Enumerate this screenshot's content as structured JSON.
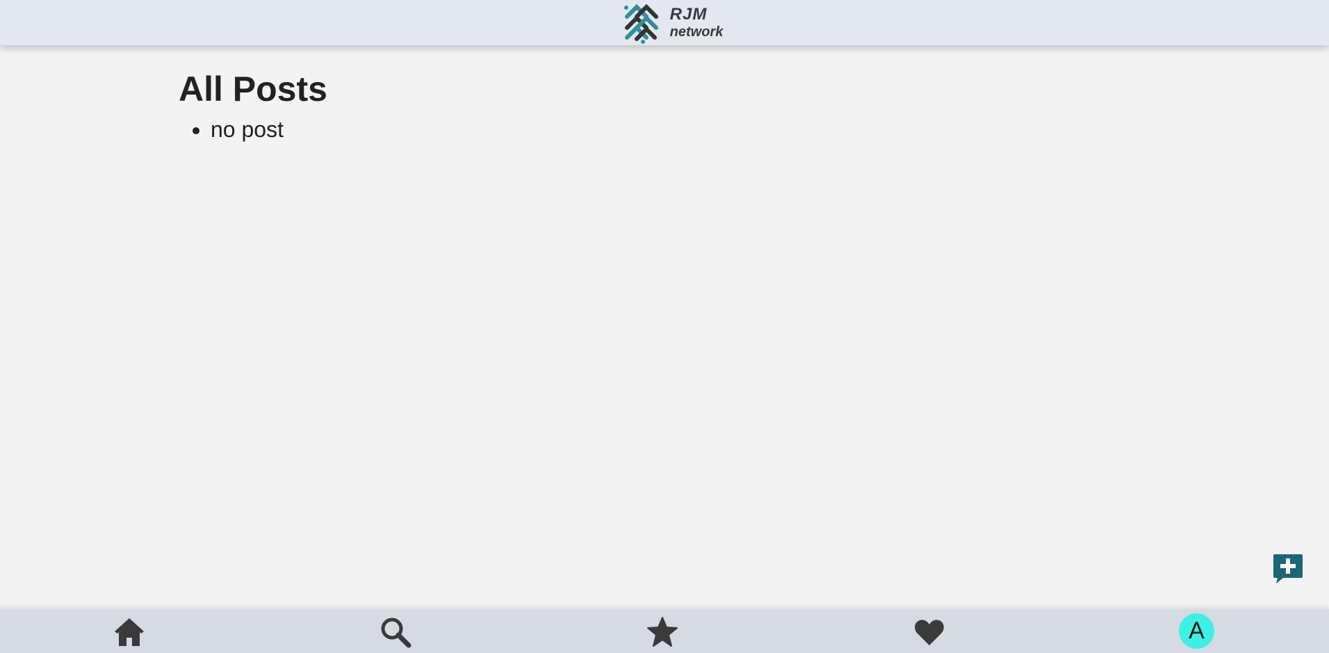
{
  "header": {
    "logo_line1": "RJM",
    "logo_line2": "network"
  },
  "main": {
    "title": "All Posts",
    "posts": [
      "no post"
    ]
  },
  "fab": {
    "icon": "comment-plus-icon",
    "color": "#1d6577"
  },
  "bottom_nav": {
    "items": [
      {
        "icon": "home-icon"
      },
      {
        "icon": "search-icon"
      },
      {
        "icon": "star-icon"
      },
      {
        "icon": "heart-icon"
      }
    ],
    "icon_color": "#3a3a3a",
    "avatar": {
      "initial": "A",
      "color": "#3ef0e3"
    }
  },
  "colors": {
    "background": "#f3f3f3",
    "topbar": "#e3e8ef",
    "bottombar": "#d6dbe1",
    "logo_teal": "#2f8f9d"
  }
}
